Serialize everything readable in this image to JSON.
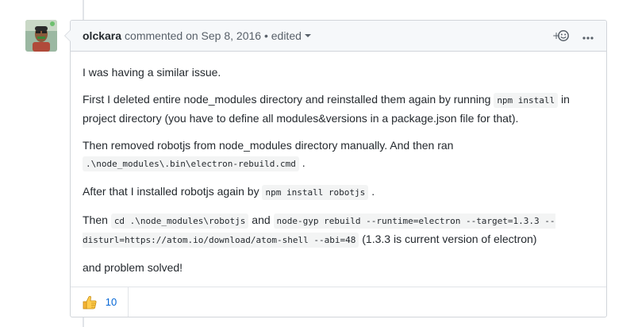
{
  "comment": {
    "author": "olckara",
    "action": "commented on",
    "date": "Sep 8, 2016",
    "separator": "•",
    "edited_label": "edited",
    "actions": {
      "add_reaction_icon": "smiley-plus-icon",
      "more_icon": "kebab-horizontal-icon"
    },
    "body": {
      "p1": "I was having a similar issue.",
      "p2_a": "First I deleted entire node_modules directory and reinstalled them again by running ",
      "p2_code": "npm install",
      "p2_b": " in project directory (you have to define all modules&versions in a package.json file for that).",
      "p3_a": "Then removed robotjs from node_modules directory manually. And then ran ",
      "p3_code": ".\\node_modules\\.bin\\electron-rebuild.cmd",
      "p3_b": " .",
      "p4_a": "After that I installed robotjs again by ",
      "p4_code": "npm install robotjs",
      "p4_b": " .",
      "p5_a": "Then ",
      "p5_code1": "cd .\\node_modules\\robotjs",
      "p5_mid": " and ",
      "p5_code2": "node-gyp rebuild --runtime=electron --target=1.3.3 --disturl=https://atom.io/download/atom-shell --abi=48",
      "p5_b": " (1.3.3 is current version of electron)",
      "p6": "and problem solved!"
    },
    "reactions": [
      {
        "icon": "thumbs-up-icon",
        "count": "10"
      }
    ]
  },
  "colors": {
    "link": "#0366d6",
    "border": "#d1d5da",
    "header_bg": "#f6f8fa",
    "muted": "#586069"
  }
}
